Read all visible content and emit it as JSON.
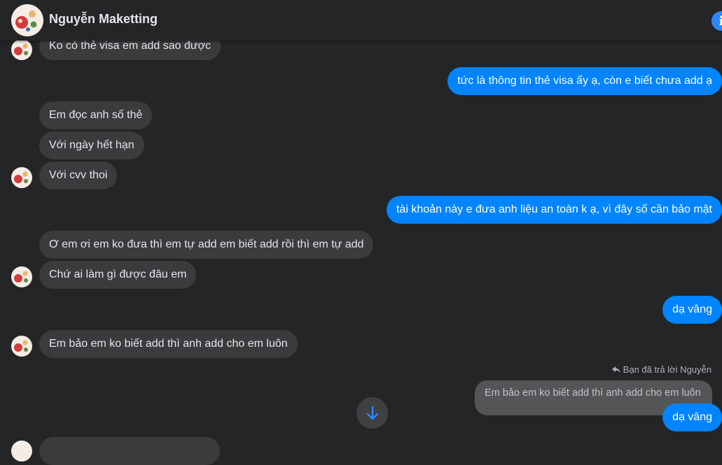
{
  "header": {
    "contact_name": "Nguyễn Maketting",
    "info_icon": "info-icon",
    "info_glyph": "i",
    "accent": "#0084ff"
  },
  "messages": {
    "m1": "Ko có thẻ visa em add sao được",
    "m2": "tức là thông tin thẻ visa ấy ạ, còn e biết chưa add ạ",
    "m3": "Em đọc anh số thẻ",
    "m4": "Với ngày hết hạn",
    "m5": "Với cvv thoi",
    "m6": "tài khoản này e đưa anh liệu an toàn k ạ, vì đây số cần bảo mật",
    "m7": "Ơ em ơi em ko đưa thì em tự add em biết add rồi thì em tự add",
    "m8": "Chứ ai làm gì được đâu em",
    "m9": "dạ vâng",
    "m10": "Em bảo em ko biết add thì anh add cho em luôn",
    "reply_note": "Bạn đã trả lời Nguyễn",
    "quoted": "Em bảo em ko biết add thì anh add cho em luôn",
    "m11": "dạ vâng"
  },
  "colors": {
    "incoming_bubble": "#3a3b3c",
    "outgoing_bubble": "#0084ff",
    "background": "#242526"
  },
  "icons": {
    "scroll_down": "arrow-down-icon",
    "reply": "reply-icon"
  }
}
